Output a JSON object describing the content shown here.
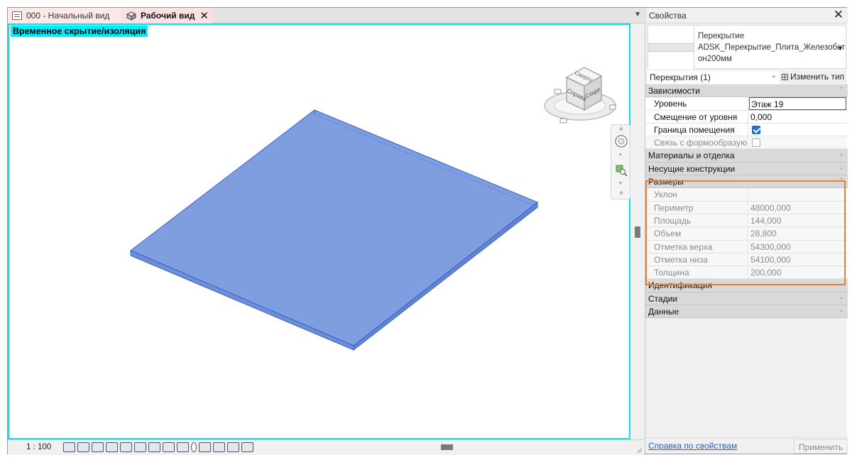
{
  "tabs": [
    {
      "label": "000 - Начальный вид",
      "icon": "floor-plan-icon",
      "active": false
    },
    {
      "label": "Рабочий вид",
      "icon": "3d-view-icon",
      "active": true
    }
  ],
  "viewport": {
    "isolation_label": "Временное скрытие/изоляция",
    "viewcube": {
      "face_right": "Справа",
      "face_top": "Сверху",
      "face_front": "Сзади"
    },
    "accent_color": "#00e5f2",
    "slab_color": "#7f9ee0"
  },
  "status": {
    "scale": "1 : 100"
  },
  "properties": {
    "title": "Свойства",
    "type": {
      "line1": "Перекрытие",
      "line2": "ADSK_Перекрытие_Плита_Железобет",
      "line3": "он200мм"
    },
    "filter": "Перекрытия (1)",
    "edit_type": "Изменить тип",
    "groups": {
      "constraints": "Зависимости",
      "materials": "Материалы и отделка",
      "structural": "Несущие конструкции",
      "dimensions": "Размеры",
      "identity": "Идентификация",
      "phasing": "Стадии",
      "data": "Данные"
    },
    "constraints": {
      "level": {
        "name": "Уровень",
        "value": "Этаж 19"
      },
      "offset": {
        "name": "Смещение от уровня",
        "value": "0,000"
      },
      "room_bounding": {
        "name": "Граница помещения",
        "checked": true
      },
      "related_mass": {
        "name": "Связь с формообразую...",
        "checked": false
      }
    },
    "dimensions": {
      "slope": {
        "name": "Уклон",
        "value": ""
      },
      "perimeter": {
        "name": "Периметр",
        "value": "48000,000"
      },
      "area": {
        "name": "Площадь",
        "value": "144,000"
      },
      "volume": {
        "name": "Объем",
        "value": "28,800"
      },
      "top_elev": {
        "name": "Отметка верха",
        "value": "54300,000"
      },
      "bottom_elev": {
        "name": "Отметка низа",
        "value": "54100,000"
      },
      "thickness": {
        "name": "Толщина",
        "value": "200,000"
      }
    },
    "help_link": "Справка по свойствам",
    "apply": "Применить",
    "highlight_color": "#e8822f"
  }
}
